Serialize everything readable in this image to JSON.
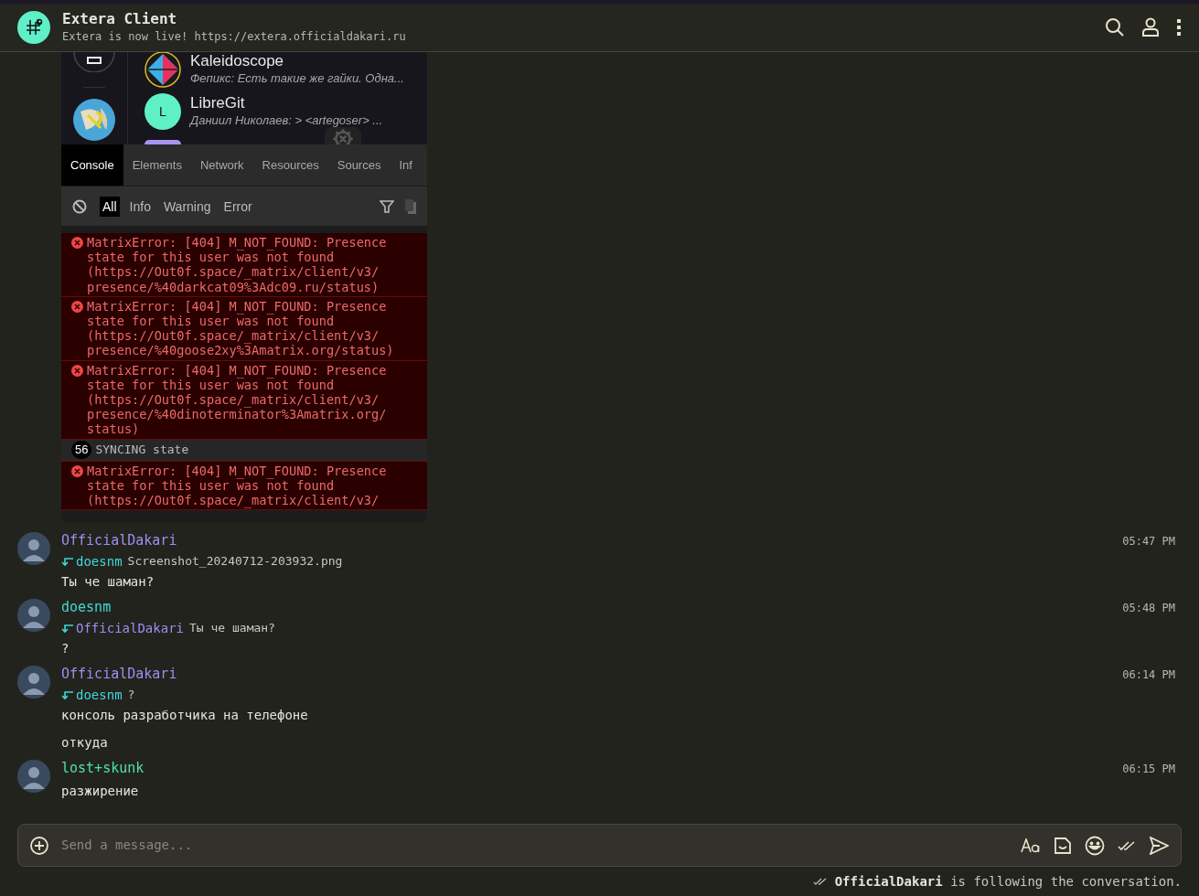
{
  "header": {
    "title": "Extera Client",
    "subtitle": "Extera is now live! https://extera.officialdakari.ru"
  },
  "embedded_screenshot": {
    "rooms": [
      {
        "name": "Kaleidoscope",
        "preview": "Фепикс: Есть такие же гайки. Одна...",
        "kind": "kaleido"
      },
      {
        "name": "LibreGit",
        "preview": "Даниил Николаев: > <artegoser> ...",
        "kind": "initial",
        "initial": "L"
      }
    ],
    "tabs": [
      {
        "label": "Console",
        "selected": true
      },
      {
        "label": "Elements",
        "selected": false
      },
      {
        "label": "Network",
        "selected": false
      },
      {
        "label": "Resources",
        "selected": false
      },
      {
        "label": "Sources",
        "selected": false
      },
      {
        "label": "Inf",
        "selected": false
      }
    ],
    "filters": [
      {
        "label": "All",
        "selected": true
      },
      {
        "label": "Info",
        "selected": false
      },
      {
        "label": "Warning",
        "selected": false
      },
      {
        "label": "Error",
        "selected": false
      }
    ],
    "log": [
      {
        "kind": "error",
        "text": "MatrixError: [404] M_NOT_FOUND: Presence state for this user was not found (https://Out0f.space/_matrix/client/v3/ presence/%40darkcat09%3Adc09.ru/status)"
      },
      {
        "kind": "error",
        "text": "MatrixError: [404] M_NOT_FOUND: Presence state for this user was not found (https://Out0f.space/_matrix/client/v3/ presence/%40goose2xy%3Amatrix.org/status)"
      },
      {
        "kind": "error",
        "text": "MatrixError: [404] M_NOT_FOUND: Presence state for this user was not found (https://Out0f.space/_matrix/client/v3/ presence/%40dinoterminator%3Amatrix.org/ status)"
      },
      {
        "kind": "group",
        "count": "56",
        "text": "SYNCING state"
      },
      {
        "kind": "error",
        "text": "MatrixError: [404] M_NOT_FOUND: Presence state for this user was not found (https://Out0f.space/_matrix/client/v3/"
      }
    ]
  },
  "messages": [
    {
      "sender": "OfficialDakari",
      "color": "#9b8ff0",
      "time": "05:47 PM",
      "reply": {
        "to": "doesnm",
        "color": "#3fd8d8",
        "text": "Screenshot_20240712-203932.png"
      },
      "lines": [
        "Ты че шаман?"
      ]
    },
    {
      "sender": "doesnm",
      "color": "#3fd8d8",
      "time": "05:48 PM",
      "reply": {
        "to": "OfficialDakari",
        "color": "#9b8ff0",
        "text": "Ты че шаман?"
      },
      "lines": [
        "?"
      ]
    },
    {
      "sender": "OfficialDakari",
      "color": "#9b8ff0",
      "time": "06:14 PM",
      "reply": {
        "to": "doesnm",
        "color": "#3fd8d8",
        "text": "?"
      },
      "lines": [
        "консоль разработчика на телефоне",
        "откуда"
      ]
    },
    {
      "sender": "lost+skunk",
      "color": "#4fe0b0",
      "time": "06:15 PM",
      "lines": [
        "разжирение"
      ]
    }
  ],
  "composer": {
    "placeholder": "Send a message..."
  },
  "status": {
    "user": "OfficialDakari",
    "text": "is following the conversation."
  }
}
